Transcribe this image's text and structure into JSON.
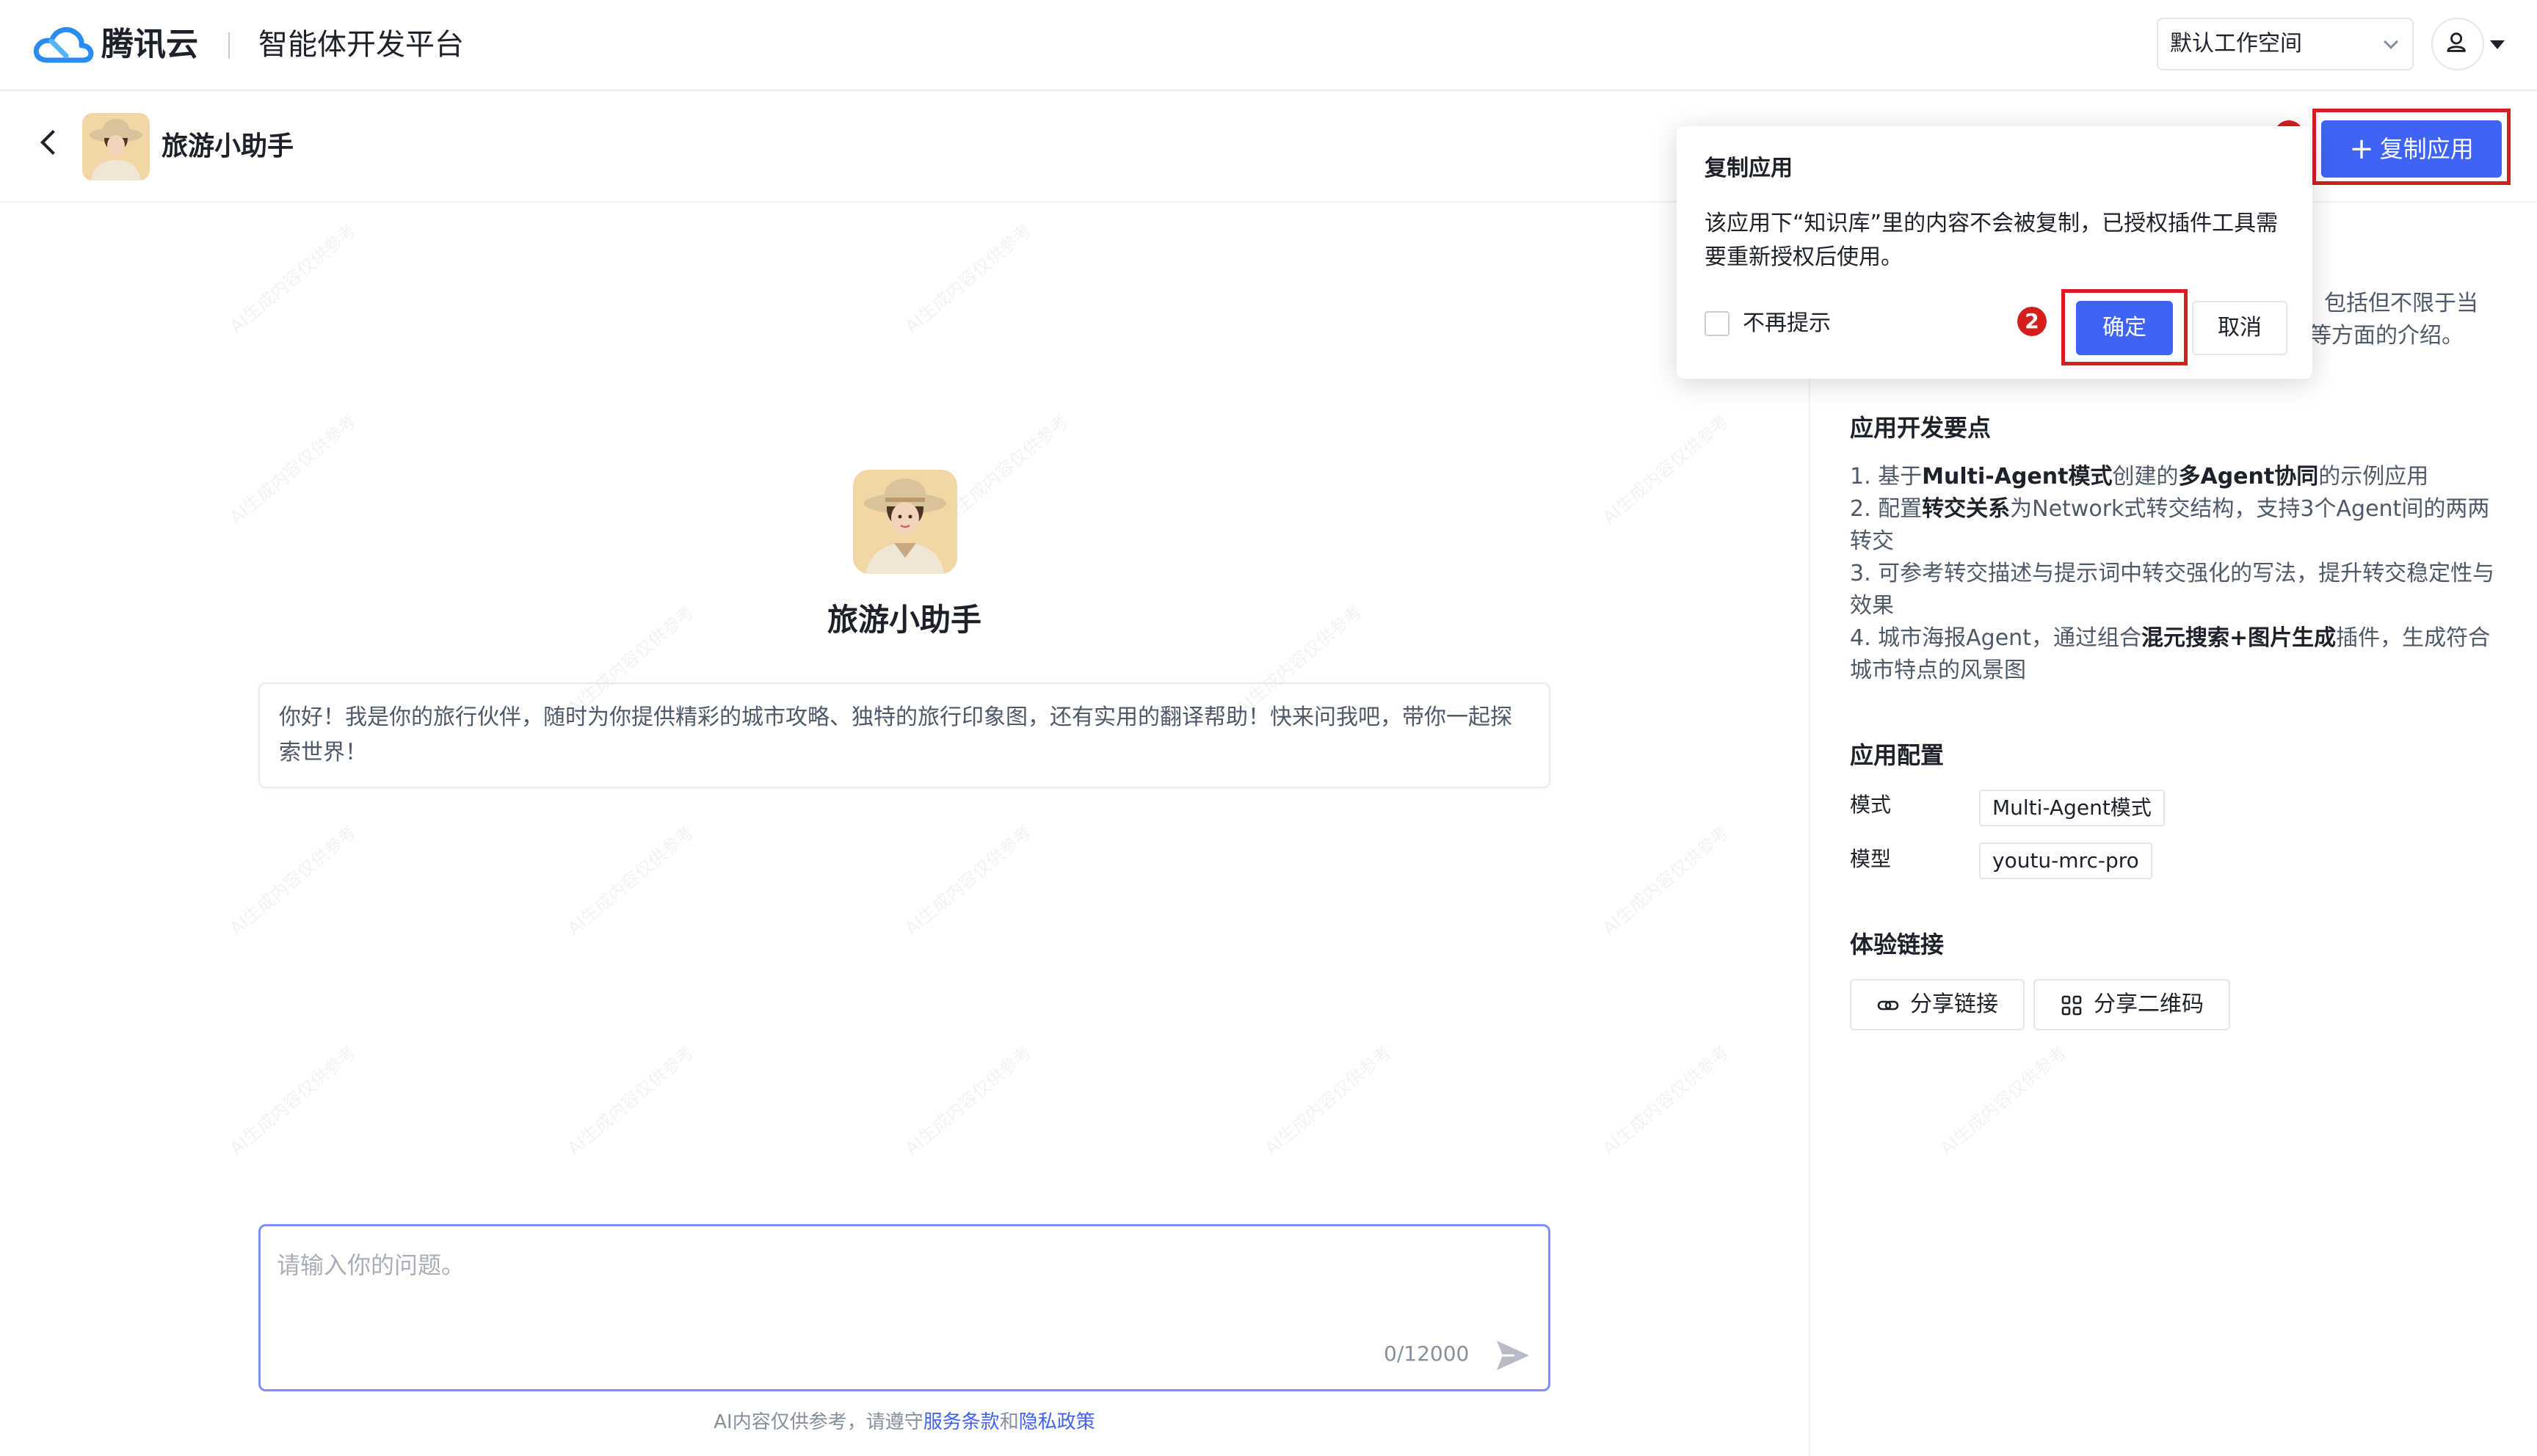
{
  "topbar": {
    "brand": "腾讯云",
    "platform": "智能体开发平台",
    "workspace": "默认工作空间"
  },
  "app": {
    "name": "旅游小助手",
    "copy_button": "复制应用"
  },
  "popconfirm": {
    "title": "复制应用",
    "message": "该应用下“知识库”里的内容不会被复制，已授权插件工具需要重新授权后使用。",
    "checkbox_label": "不再提示",
    "ok_label": "确定",
    "cancel_label": "取消"
  },
  "steps": {
    "one": "1",
    "two": "2"
  },
  "chat": {
    "title": "旅游小助手",
    "greeting": "你好！我是你的旅行伙伴，随时为你提供精彩的城市攻略、独特的旅行印象图，还有实用的翻译帮助！快来问我吧，带你一起探索世界！",
    "input_placeholder": "请输入你的问题。",
    "counter": "0/12000",
    "disclaimer_prefix": "AI内容仅供参考，请遵守",
    "terms_link": "服务条款",
    "and": "和",
    "privacy_link": "隐私政策"
  },
  "watermark_text": "AI生成内容仅供参考",
  "panel": {
    "intro_line1": "包括但不限于当",
    "intro_line2": "等方面的介绍。",
    "dev_points_title": "应用开发要点",
    "dev_points": [
      {
        "a": "1. 基于",
        "b": "Multi-Agent模式",
        "c": "创建的",
        "d": "多Agent协同",
        "e": "的示例应用"
      },
      {
        "a": "2. 配置",
        "b": "转交关系",
        "c": "为Network式转交结构，支持3个Agent间的两两转交",
        "d": "",
        "e": ""
      },
      {
        "a": "3. 可参考转交描述与提示词中转交强化的写法，提升转交稳定性与效果",
        "b": "",
        "c": "",
        "d": "",
        "e": ""
      },
      {
        "a": "4. 城市海报Agent，通过组合",
        "b": "混元搜索+图片生成",
        "c": "插件，生成符合城市特点的风景图",
        "d": "",
        "e": ""
      }
    ],
    "config_title": "应用配置",
    "mode_label": "模式",
    "mode_value": "Multi-Agent模式",
    "model_label": "模型",
    "model_value": "youtu-mrc-pro",
    "links_title": "体验链接",
    "share_link": "分享链接",
    "share_qr": "分享二维码"
  },
  "colors": {
    "primary": "#3e63f5",
    "highlight": "#d51e1e"
  }
}
